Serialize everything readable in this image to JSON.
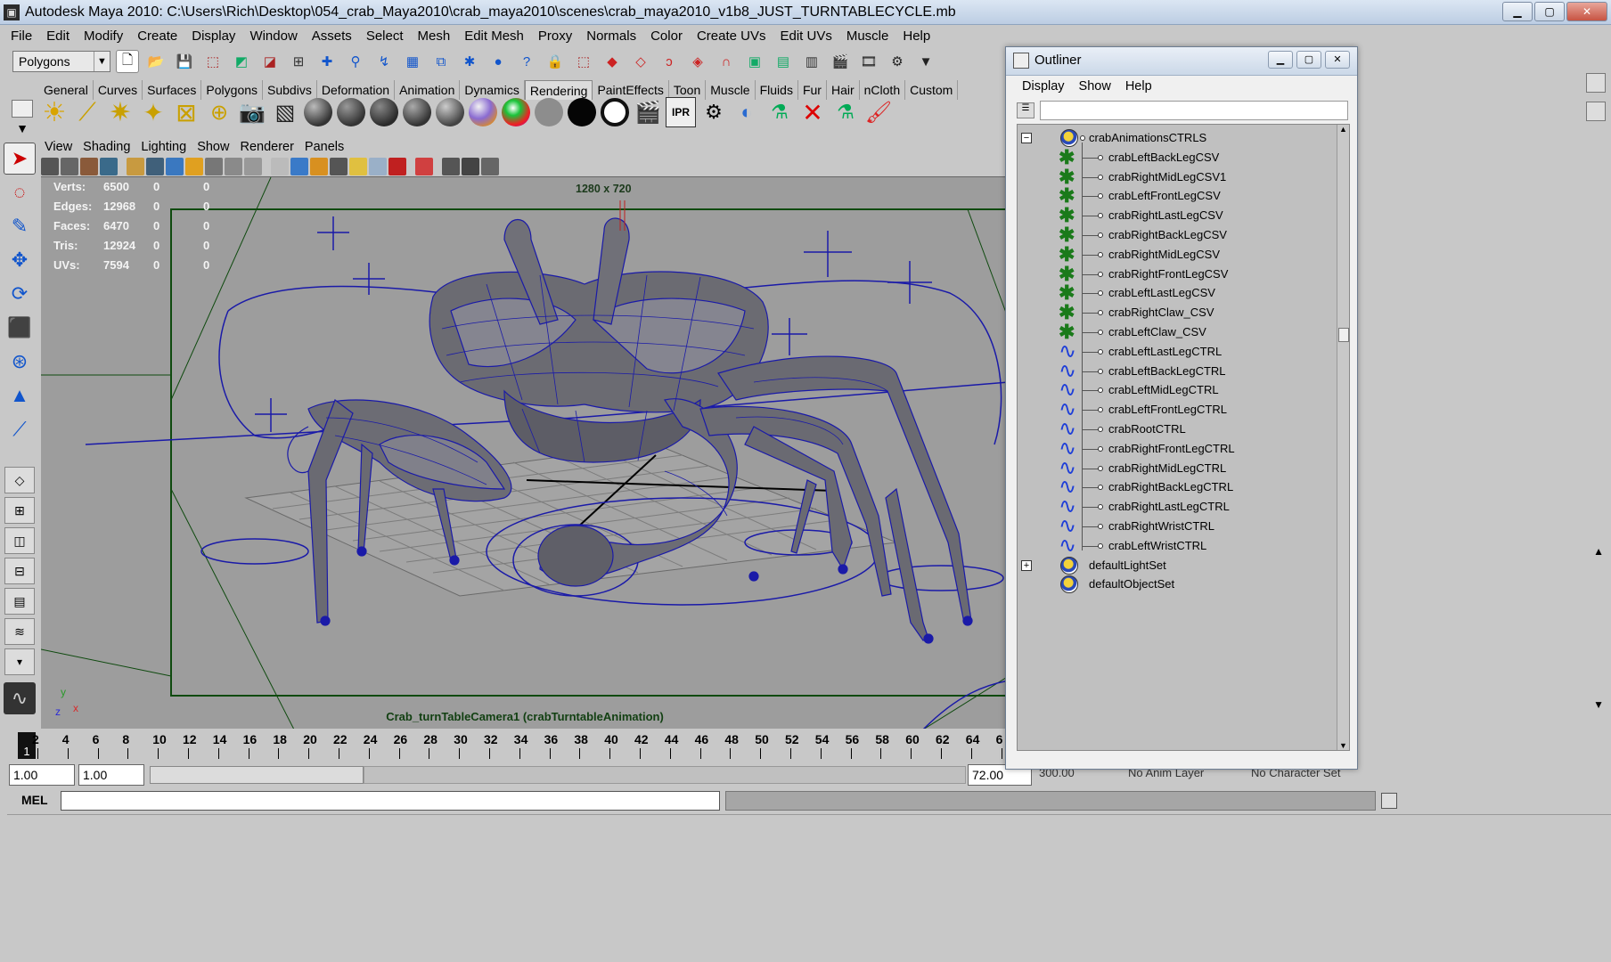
{
  "window": {
    "title": "Autodesk Maya 2010: C:\\Users\\Rich\\Desktop\\054_crab_Maya2010\\crab_maya2010\\scenes\\crab_maya2010_v1b8_JUST_TURNTABLECYCLE.mb"
  },
  "menubar": [
    "File",
    "Edit",
    "Modify",
    "Create",
    "Display",
    "Window",
    "Assets",
    "Select",
    "Mesh",
    "Edit Mesh",
    "Proxy",
    "Normals",
    "Color",
    "Create UVs",
    "Edit UVs",
    "Muscle",
    "Help"
  ],
  "status_line": {
    "mode": "Polygons"
  },
  "shelf_tabs": [
    "General",
    "Curves",
    "Surfaces",
    "Polygons",
    "Subdivs",
    "Deformation",
    "Animation",
    "Dynamics",
    "Rendering",
    "PaintEffects",
    "Toon",
    "Muscle",
    "Fluids",
    "Fur",
    "Hair",
    "nCloth",
    "Custom"
  ],
  "active_shelf_tab": "Rendering",
  "panel_menu": [
    "View",
    "Shading",
    "Lighting",
    "Show",
    "Renderer",
    "Panels"
  ],
  "hud": {
    "rows": [
      {
        "label": "Verts:",
        "v1": "6500",
        "v2": "0",
        "v3": "0"
      },
      {
        "label": "Edges:",
        "v1": "12968",
        "v2": "0",
        "v3": "0"
      },
      {
        "label": "Faces:",
        "v1": "6470",
        "v2": "0",
        "v3": "0"
      },
      {
        "label": "Tris:",
        "v1": "12924",
        "v2": "0",
        "v3": "0"
      },
      {
        "label": "UVs:",
        "v1": "7594",
        "v2": "0",
        "v3": "0"
      }
    ],
    "resolution": "1280 x 720",
    "camera": "Crab_turnTableCamera1 (crabTurntableAnimation)",
    "axis_y": "y",
    "axis_z": "z",
    "axis_x": "x"
  },
  "time_slider": {
    "current_frame": "1",
    "ticks": [
      "2",
      "4",
      "6",
      "8",
      "10",
      "12",
      "14",
      "16",
      "18",
      "20",
      "22",
      "24",
      "26",
      "28",
      "30",
      "32",
      "34",
      "36",
      "38",
      "40",
      "42",
      "44",
      "46",
      "48",
      "50",
      "52",
      "54",
      "56",
      "58",
      "60",
      "62",
      "64",
      "6"
    ]
  },
  "range_slider": {
    "start": "1.00",
    "playback_start": "1.00",
    "playback_end": "72.00",
    "end": "300.00",
    "anim_layer": "No Anim Layer",
    "character_set": "No Character Set"
  },
  "command_line": {
    "label": "MEL"
  },
  "outliner": {
    "title": "Outliner",
    "menu": [
      "Display",
      "Show",
      "Help"
    ],
    "items": [
      {
        "label": "crabAnimationsCTRLS",
        "type": "set",
        "level": 0,
        "expander": "−"
      },
      {
        "label": "crabLeftBackLegCSV",
        "type": "cluster",
        "level": 1
      },
      {
        "label": "crabRightMidLegCSV1",
        "type": "cluster",
        "level": 1
      },
      {
        "label": "crabLeftFrontLegCSV",
        "type": "cluster",
        "level": 1
      },
      {
        "label": "crabRightLastLegCSV",
        "type": "cluster",
        "level": 1
      },
      {
        "label": "crabRightBackLegCSV",
        "type": "cluster",
        "level": 1
      },
      {
        "label": "crabRightMidLegCSV",
        "type": "cluster",
        "level": 1
      },
      {
        "label": "crabRightFrontLegCSV",
        "type": "cluster",
        "level": 1
      },
      {
        "label": "crabLeftLastLegCSV",
        "type": "cluster",
        "level": 1
      },
      {
        "label": "crabRightClaw_CSV",
        "type": "cluster",
        "level": 1
      },
      {
        "label": "crabLeftClaw_CSV",
        "type": "cluster",
        "level": 1
      },
      {
        "label": "crabLeftLastLegCTRL",
        "type": "curve",
        "level": 1
      },
      {
        "label": "crabLeftBackLegCTRL",
        "type": "curve",
        "level": 1
      },
      {
        "label": "crabLeftMidLegCTRL",
        "type": "curve",
        "level": 1
      },
      {
        "label": "crabLeftFrontLegCTRL",
        "type": "curve",
        "level": 1
      },
      {
        "label": "crabRootCTRL",
        "type": "curve",
        "level": 1
      },
      {
        "label": "crabRightFrontLegCTRL",
        "type": "curve",
        "level": 1
      },
      {
        "label": "crabRightMidLegCTRL",
        "type": "curve",
        "level": 1
      },
      {
        "label": "crabRightBackLegCTRL",
        "type": "curve",
        "level": 1
      },
      {
        "label": "crabRightLastLegCTRL",
        "type": "curve",
        "level": 1
      },
      {
        "label": "crabRightWristCTRL",
        "type": "curve",
        "level": 1
      },
      {
        "label": "crabLeftWristCTRL",
        "type": "curve",
        "level": 1
      },
      {
        "label": "defaultLightSet",
        "type": "set",
        "level": 0,
        "expander": "+"
      },
      {
        "label": "defaultObjectSet",
        "type": "set",
        "level": 0
      }
    ]
  },
  "colors": {
    "maya_gray": "#c8c8c8",
    "viewport_bg": "#9d9d9d",
    "wireframe": "#1a1aa8",
    "cluster_green": "#1a7a1a",
    "curve_blue": "#1f3fd8"
  }
}
